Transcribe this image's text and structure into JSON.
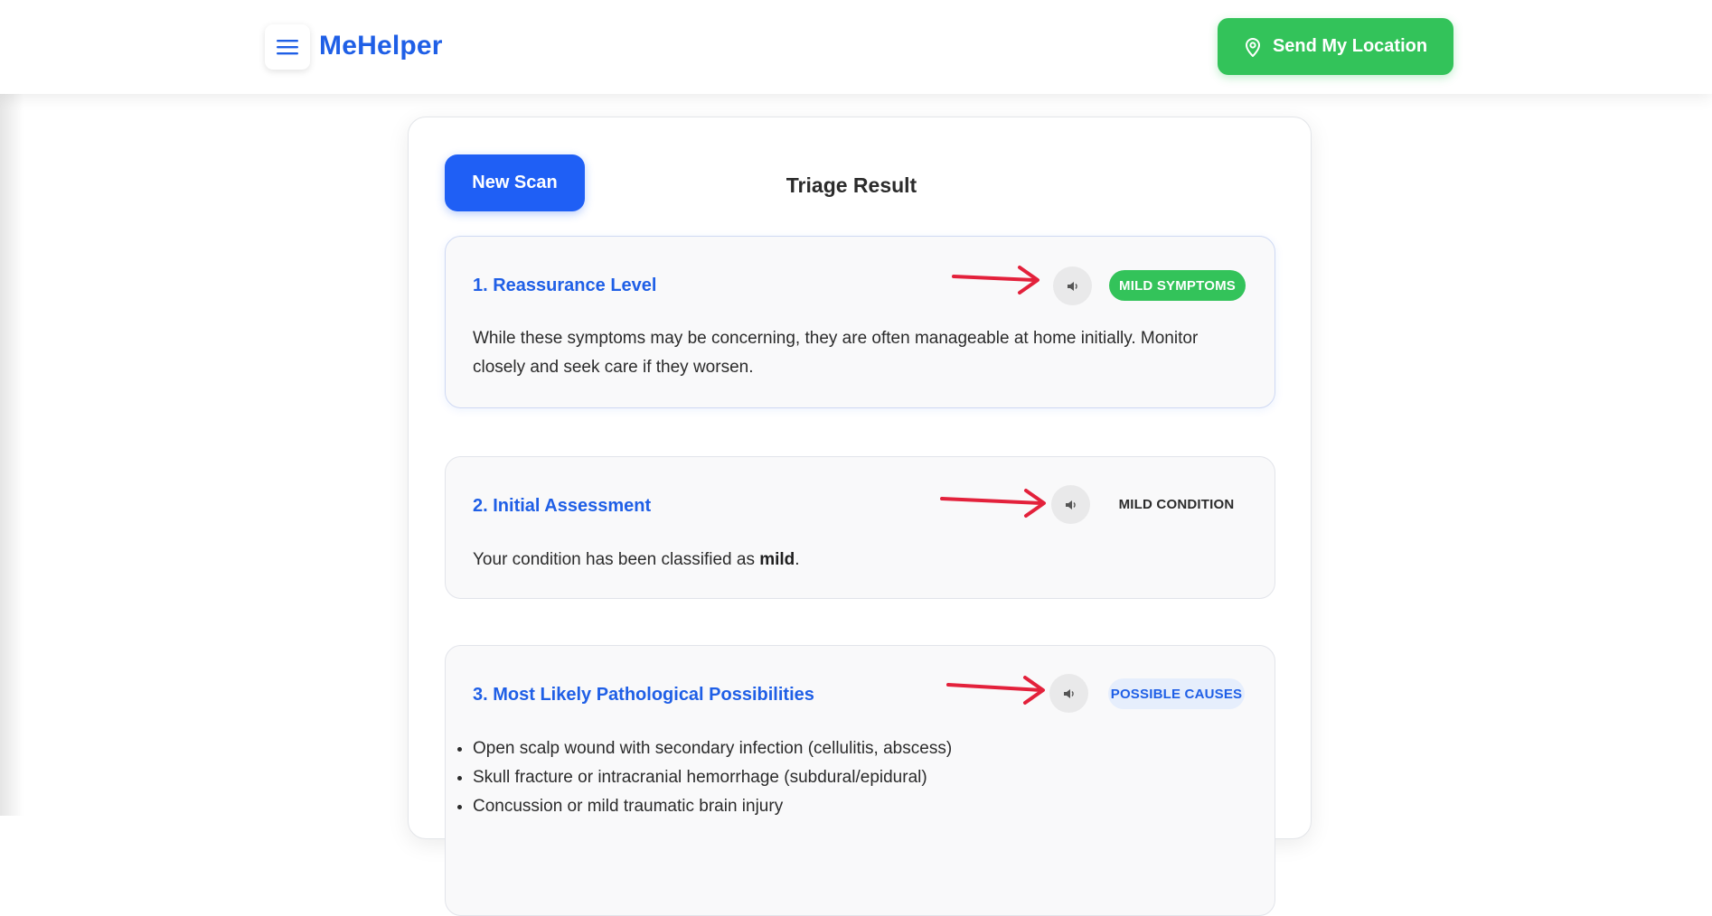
{
  "header": {
    "brand": "MeHelper",
    "menu_icon": "hamburger-menu-icon",
    "location_button": {
      "label": "Send My Location",
      "icon": "map-pin-icon"
    }
  },
  "main": {
    "new_scan_label": "New Scan",
    "title": "Triage Result",
    "sections": [
      {
        "title": "1. Reassurance Level",
        "badge": "MILD SYMPTOMS",
        "badge_color": "#33c35a",
        "speaker_icon": "speaker-icon",
        "body": "While these symptoms may be concerning, they are often manageable at home initially. Monitor closely and seek care if they worsen."
      },
      {
        "title": "2. Initial Assessment",
        "badge": "MILD CONDITION",
        "speaker_icon": "speaker-icon",
        "body_prefix": "Your condition has been classified as ",
        "body_strong": "mild",
        "body_suffix": "."
      },
      {
        "title": "3. Most Likely Pathological Possibilities",
        "badge": "POSSIBLE CAUSES",
        "badge_color": "#e6eefc",
        "speaker_icon": "speaker-icon",
        "items": [
          "Open scalp wound with secondary infection (cellulitis, abscess)",
          "Skull fracture or intracranial hemorrhage (subdural/epidural)",
          "Concussion or mild traumatic brain injury"
        ]
      }
    ]
  },
  "annotations": {
    "arrow_color": "#e3213b"
  },
  "colors": {
    "brand": "#1f5fe6",
    "primary_button": "#1f5ff5",
    "success": "#33c35a"
  }
}
